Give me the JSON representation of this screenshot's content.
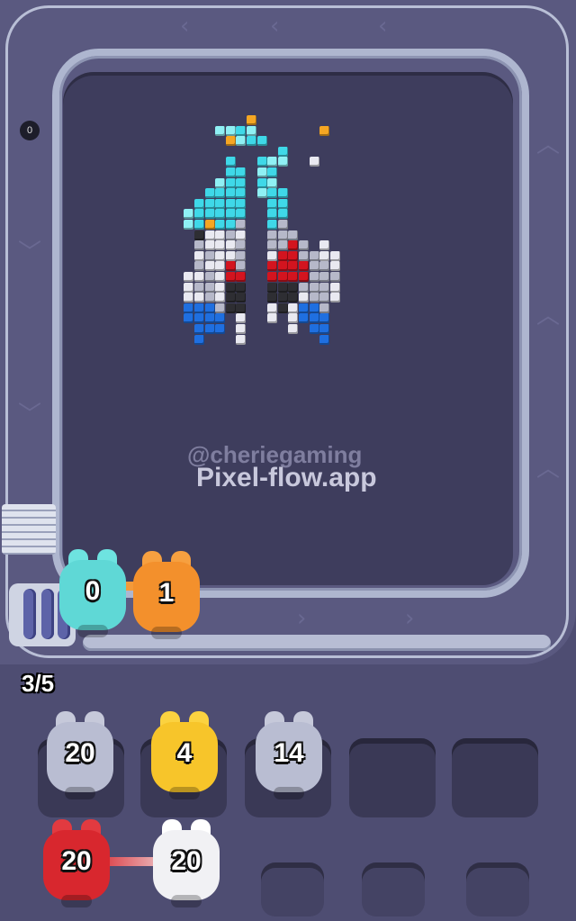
{
  "watermark": {
    "handle": "@cheriegaming",
    "site": "Pixel-flow.app"
  },
  "hud": {
    "queue_counter": "3/5"
  },
  "conveyor_pigs": [
    {
      "id": "cyan",
      "count": "0",
      "color": "#5fd8d6"
    },
    {
      "id": "orange",
      "count": "1",
      "color": "#f3902c"
    }
  ],
  "holding_slots": [
    {
      "slot": 1,
      "count": "20",
      "color": "#b9bdd2"
    },
    {
      "slot": 2,
      "count": "4",
      "color": "#f7c52a"
    },
    {
      "slot": 3,
      "count": "14",
      "color": "#b9bdd2"
    },
    {
      "slot": 4,
      "count": "",
      "color": ""
    },
    {
      "slot": 5,
      "count": "",
      "color": ""
    }
  ],
  "queue_pigs": [
    {
      "id": "red",
      "count": "20",
      "color": "#d8272e"
    },
    {
      "id": "white",
      "count": "20",
      "color": "#f1f1f4"
    }
  ],
  "pixel_art": {
    "subject": "jet",
    "palette": {
      "cyan": "#3fd8e8",
      "lightcyan": "#8ff0f4",
      "white": "#e9e9f1",
      "gray": "#b6b8c9",
      "red": "#d3141f",
      "dark": "#2e2e33",
      "blue": "#1f6fe0",
      "orange": "#f5a623"
    }
  },
  "side_marker": {
    "icon": "bomb-icon",
    "label": "0"
  },
  "colors": {
    "board": "#3e3d5d",
    "track": "#5a5980",
    "rail": "#b7bdd4"
  }
}
